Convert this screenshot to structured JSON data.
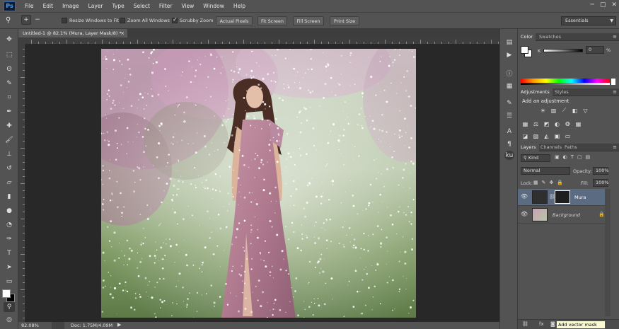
{
  "app": {
    "logo": "Ps",
    "menu": [
      "File",
      "Edit",
      "Image",
      "Layer",
      "Type",
      "Select",
      "Filter",
      "View",
      "Window",
      "Help"
    ],
    "window_controls": [
      "─",
      "▢",
      "✕"
    ]
  },
  "options_bar": {
    "zoom_in_icon": "zoom-in-icon",
    "zoom_out_icon": "zoom-out-icon",
    "resize_windows_label": "Resize Windows to Fit",
    "zoom_all_label": "Zoom All Windows",
    "scrubby_label": "Scrubby Zoom",
    "scrubby_checked": true,
    "actual_pixels": "Actual Pixels",
    "fit_screen": "Fit Screen",
    "fill_screen": "Fill Screen",
    "print_size": "Print Size",
    "workspace": "Essentials"
  },
  "document": {
    "tab_title": "Untitled-1 @ 82.1% (Mura, Layer Mask/8) *",
    "close": "×"
  },
  "status": {
    "zoom": "82.08%",
    "doc": "Doc: 1.75M/4.09M"
  },
  "color_panel": {
    "tabs": [
      "Color",
      "Swatches"
    ],
    "channel_label": "K",
    "value": "0",
    "unit": "%"
  },
  "adjustments_panel": {
    "tabs": [
      "Adjustments",
      "Styles"
    ],
    "heading": "Add an adjustment"
  },
  "layers_panel": {
    "tabs": [
      "Layers",
      "Channels",
      "Paths"
    ],
    "filter_kind": "Kind",
    "blend_mode": "Normal",
    "opacity_label": "Opacity:",
    "opacity_value": "100%",
    "lock_label": "Lock:",
    "fill_label": "Fill:",
    "fill_value": "100%",
    "layers": [
      {
        "name": "Mura",
        "selected": true
      },
      {
        "name": "Background",
        "selected": false
      }
    ]
  },
  "tooltip": "Add vector mask",
  "colors": {
    "ui_dark": "#535353",
    "canvas_bg": "#282828",
    "selected_layer": "#5b6b82",
    "accent": "#4fa3e6"
  }
}
